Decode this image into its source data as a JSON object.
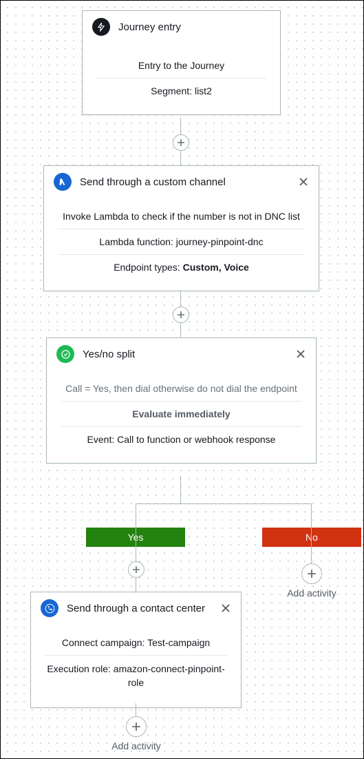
{
  "entry": {
    "title": "Journey entry",
    "body_line1": "Entry to the Journey",
    "segment_label": "Segment: list2"
  },
  "custom_channel": {
    "title": "Send through a custom channel",
    "body_desc": "Invoke Lambda to check if the number is not in DNC list",
    "lambda_label": "Lambda function: journey-pinpoint-dnc",
    "endpoint_prefix": "Endpoint types: ",
    "endpoint_value": "Custom, Voice"
  },
  "split": {
    "title": "Yes/no split",
    "condition": "Call = Yes, then dial otherwise do not dial the endpoint",
    "evaluate": "Evaluate immediately",
    "event": "Event:   Call to function or webhook response",
    "yes_label": "Yes",
    "no_label": "No"
  },
  "contact_center": {
    "title": "Send through a contact center",
    "campaign": "Connect campaign: Test-campaign",
    "role": "Execution role: amazon-connect-pinpoint-role"
  },
  "add_activity_label": "Add activity"
}
